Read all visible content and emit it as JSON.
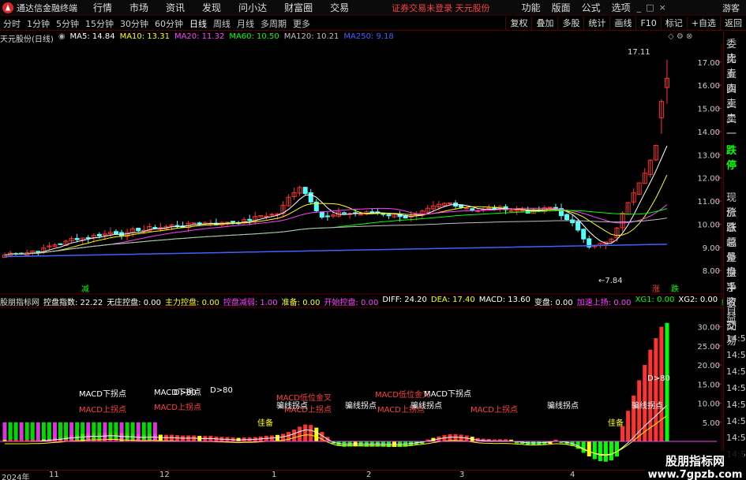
{
  "topbar": {
    "title": "通达信金融终端",
    "menus": [
      "行情",
      "市场",
      "资讯",
      "发现",
      "问小达",
      "财富圈",
      "交易"
    ],
    "login": "证券交易未登录  天元股份",
    "right": [
      "功能",
      "版面",
      "公式",
      "选项"
    ],
    "guest": "游客"
  },
  "periods": [
    "分时",
    "1分钟",
    "5分钟",
    "15分钟",
    "30分钟",
    "60分钟",
    "日线",
    "周线",
    "月线",
    "多周期",
    "更多"
  ],
  "active_period": "日线",
  "tools": [
    "复权",
    "叠加",
    "多股",
    "统计",
    "画线",
    "F10",
    "标记",
    "+自选",
    "返回"
  ],
  "main_legend": {
    "stock": "天元股份(日线)",
    "ma": [
      {
        "label": "MA5: 14.84",
        "color": "#ffffff"
      },
      {
        "label": "MA10: 13.31",
        "color": "#ffff00"
      },
      {
        "label": "MA20: 11.32",
        "color": "#ff40ff"
      },
      {
        "label": "MA60: 10.50",
        "color": "#00ff00"
      },
      {
        "label": "MA120: 10.21",
        "color": "#c0c0c0"
      },
      {
        "label": "MA250: 9.18",
        "color": "#4060ff"
      }
    ]
  },
  "indicator_legend": {
    "name": "股朋指标网",
    "items": [
      {
        "label": "控盘指数: 22.22",
        "color": "#ffffff"
      },
      {
        "label": "无庄控盘: 0.00",
        "color": "#ffffff"
      },
      {
        "label": "主力控盘: 0.00",
        "color": "#ffff00"
      },
      {
        "label": "控盘减弱: 1.00",
        "color": "#ff40ff"
      },
      {
        "label": "准备: 0.00",
        "color": "#ffff00"
      },
      {
        "label": "开始控盘: 0.00",
        "color": "#ff40ff"
      },
      {
        "label": "DIFF: 24.20",
        "color": "#ffffff"
      },
      {
        "label": "DEA: 17.40",
        "color": "#ffff00"
      },
      {
        "label": "MACD: 13.60",
        "color": "#ffffff"
      },
      {
        "label": "变盘: 0.00",
        "color": "#ffffff"
      },
      {
        "label": "加速上扬: 0.00",
        "color": "#ff40ff"
      },
      {
        "label": "XG1: 0.00",
        "color": "#00ff00"
      },
      {
        "label": "XG2: 0.00",
        "color": "#ffffff"
      },
      {
        "label": "绿柱起",
        "color": "#00ff00"
      }
    ]
  },
  "price_axis": [
    "17.00",
    "16.00",
    "15.00",
    "14.00",
    "13.00",
    "12.00",
    "11.00",
    "10.00",
    "9.00",
    "8.00"
  ],
  "indicator_axis": [
    "30.00",
    "25.00",
    "20.00",
    "15.00",
    "10.00",
    "5.00"
  ],
  "price_annotations": {
    "high": "17.11",
    "low": "7.84",
    "decline_mark": "减",
    "zt_mark": "涨",
    "xd_mark": "跌"
  },
  "indicator_annotations": [
    "MACD下拐点",
    "MACD上拐点",
    "MACD下拐点",
    "MACD上拐点",
    "D>80",
    "D>80",
    "MACD低位金叉",
    "MACD上拐点",
    "骗线拐点",
    "MACD低位金叉",
    "MACD上拐点",
    "MACD下拐点",
    "骗线拐点",
    "MACD上拐点",
    "骗线拐点",
    "骗线拐点",
    "D>80",
    "骗线拐点",
    "佳备",
    "佳备"
  ],
  "right_panel": [
    "委比",
    "卖五",
    "卖四",
    "卖三",
    "卖二",
    "卖一",
    "跌停",
    "现价",
    "涨跌",
    "涨幅",
    "总量",
    "外盘",
    "换手",
    "净资",
    "收益",
    "自动",
    "交易",
    "14:56",
    "14:56",
    "14:56",
    "14:56",
    "14:56",
    "14:56",
    "14:56",
    "14:56"
  ],
  "time_axis": [
    {
      "label": "2024年"
    },
    {
      "label": "11"
    },
    {
      "label": "12"
    },
    {
      "label": "1"
    },
    {
      "label": "2"
    },
    {
      "label": "3"
    },
    {
      "label": "4"
    }
  ],
  "watermark": {
    "line1": "股朋指标网",
    "line2": "www.7gpzb.com"
  },
  "colors": {
    "up": "#ff3232",
    "down": "#54ffff",
    "grid": "#5a0000",
    "ma5": "#ffffff",
    "ma10": "#ffff00",
    "ma20": "#ff40ff",
    "ma60": "#00ff00",
    "ma120": "#c0c0c0",
    "ma250": "#4060ff"
  }
}
